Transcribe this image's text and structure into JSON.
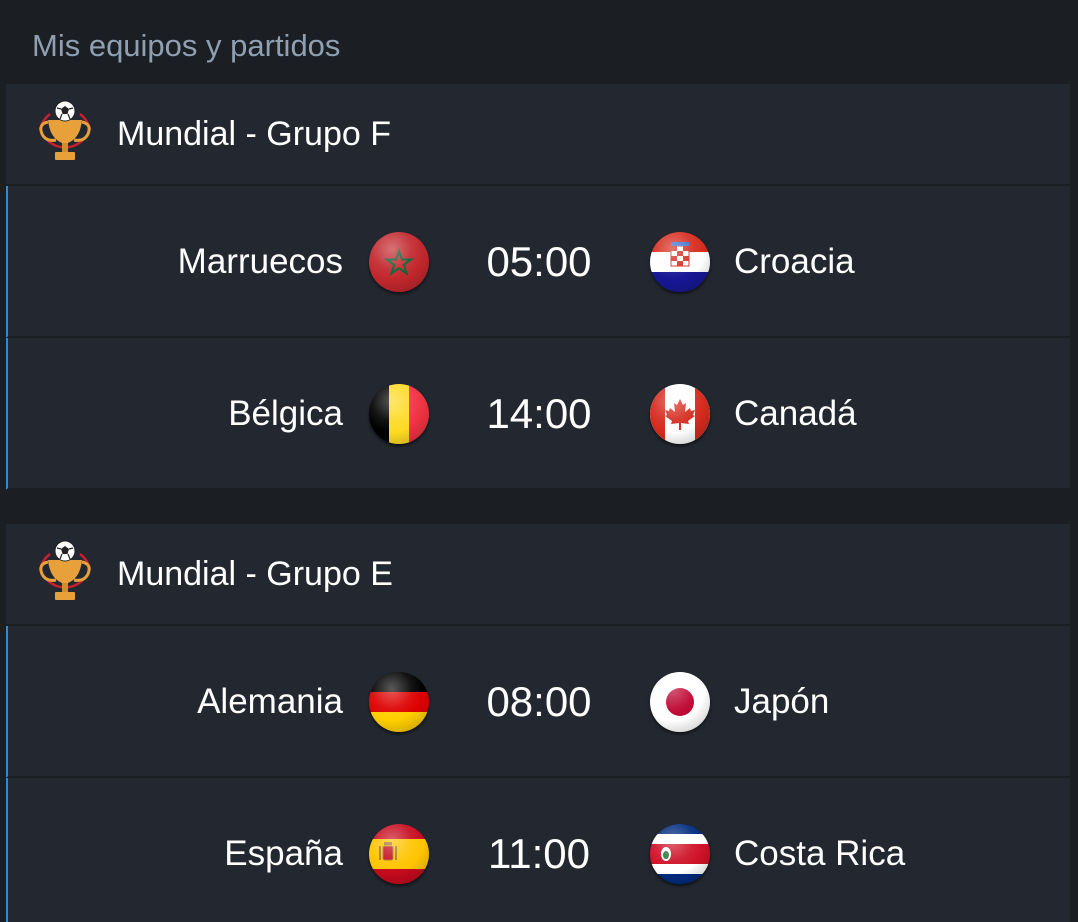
{
  "section_title": "Mis equipos y partidos",
  "groups": [
    {
      "name": "Mundial - Grupo F",
      "icon": "trophy-icon",
      "matches": [
        {
          "home": "Marruecos",
          "home_flag": "morocco-flag-icon",
          "time": "05:00",
          "away": "Croacia",
          "away_flag": "croatia-flag-icon"
        },
        {
          "home": "Bélgica",
          "home_flag": "belgium-flag-icon",
          "time": "14:00",
          "away": "Canadá",
          "away_flag": "canada-flag-icon"
        }
      ]
    },
    {
      "name": "Mundial - Grupo E",
      "icon": "trophy-icon",
      "matches": [
        {
          "home": "Alemania",
          "home_flag": "germany-flag-icon",
          "time": "08:00",
          "away": "Japón",
          "away_flag": "japan-flag-icon"
        },
        {
          "home": "España",
          "home_flag": "spain-flag-icon",
          "time": "11:00",
          "away": "Costa Rica",
          "away_flag": "costa-rica-flag-icon"
        }
      ]
    }
  ],
  "colors": {
    "background": "#1b1e23",
    "card": "#232830",
    "accent": "#3a87c8",
    "section_title": "#8fa0b3"
  }
}
